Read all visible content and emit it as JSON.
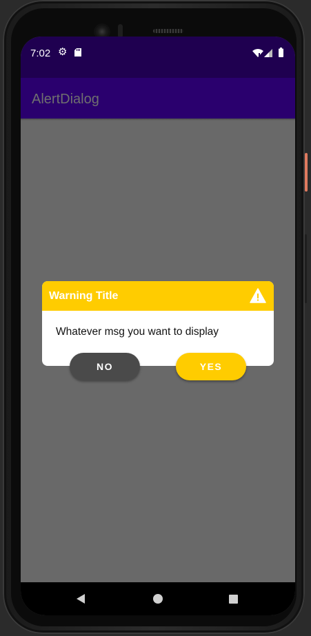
{
  "status_bar": {
    "time": "7:02",
    "icons": [
      "gear-icon",
      "sd-card-icon",
      "wifi-icon",
      "signal-icon",
      "battery-icon"
    ]
  },
  "app_bar": {
    "title": "AlertDialog"
  },
  "dialog": {
    "title": "Warning Title",
    "icon": "warning-icon",
    "message": "Whatever msg you want to display",
    "negative_label": "NO",
    "positive_label": "YES"
  },
  "nav_bar": {
    "icons": [
      "back-icon",
      "home-icon",
      "recents-icon"
    ]
  },
  "colors": {
    "status_bar": "#1f0050",
    "app_bar": "#2a006e",
    "accent": "#ffcc00",
    "scrim": "#696969",
    "button_dark": "#4a4a4a"
  }
}
